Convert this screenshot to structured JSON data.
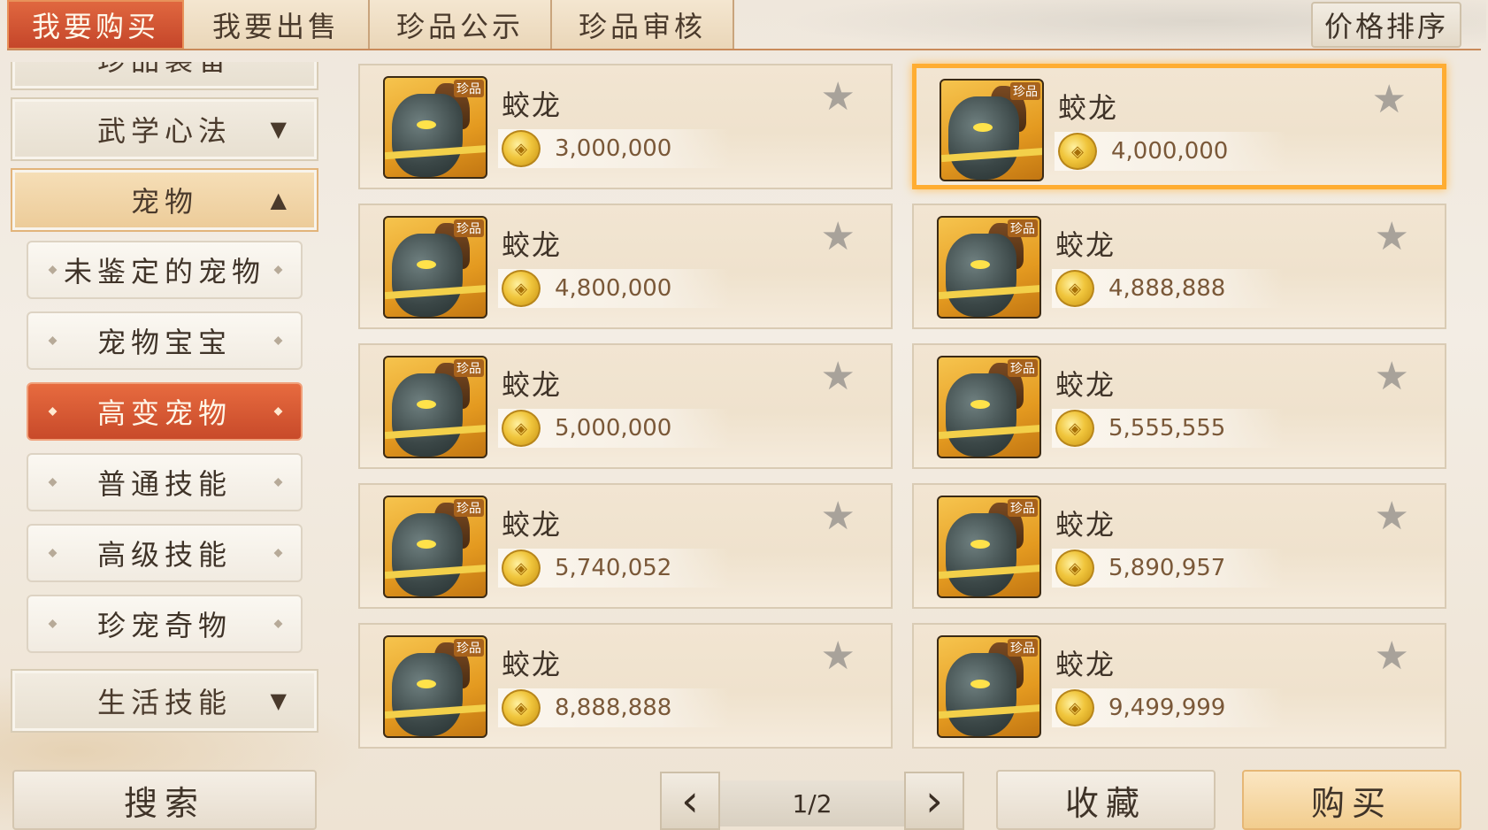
{
  "tabs": [
    {
      "label": "我要购买",
      "active": true
    },
    {
      "label": "我要出售",
      "active": false
    },
    {
      "label": "珍品公示",
      "active": false
    },
    {
      "label": "珍品审核",
      "active": false
    }
  ],
  "sort_label": "价格排序",
  "sidebar": {
    "partial_top": "珍品装备",
    "categories": [
      {
        "label": "武学心法",
        "arrow": "▼"
      },
      {
        "label": "宠物",
        "arrow": "▲"
      },
      {
        "label": "生活技能",
        "arrow": "▼"
      }
    ],
    "pet_subitems": [
      {
        "label": "未鉴定的宠物",
        "active": false
      },
      {
        "label": "宠物宝宝",
        "active": false
      },
      {
        "label": "高变宠物",
        "active": true
      },
      {
        "label": "普通技能",
        "active": false
      },
      {
        "label": "高级技能",
        "active": false
      },
      {
        "label": "珍宠奇物",
        "active": false
      }
    ]
  },
  "listings": [
    {
      "name": "蛟龙",
      "price": "3,000,000",
      "badge": "珍品",
      "selected": false
    },
    {
      "name": "蛟龙",
      "price": "4,000,000",
      "badge": "珍品",
      "selected": true
    },
    {
      "name": "蛟龙",
      "price": "4,800,000",
      "badge": "珍品",
      "selected": false
    },
    {
      "name": "蛟龙",
      "price": "4,888,888",
      "badge": "珍品",
      "selected": false
    },
    {
      "name": "蛟龙",
      "price": "5,000,000",
      "badge": "珍品",
      "selected": false
    },
    {
      "name": "蛟龙",
      "price": "5,555,555",
      "badge": "珍品",
      "selected": false
    },
    {
      "name": "蛟龙",
      "price": "5,740,052",
      "badge": "珍品",
      "selected": false
    },
    {
      "name": "蛟龙",
      "price": "5,890,957",
      "badge": "珍品",
      "selected": false
    },
    {
      "name": "蛟龙",
      "price": "8,888,888",
      "badge": "珍品",
      "selected": false
    },
    {
      "name": "蛟龙",
      "price": "9,499,999",
      "badge": "珍品",
      "selected": false
    }
  ],
  "bottom": {
    "search_label": "搜索",
    "page_indicator": "1/2",
    "favorite_label": "收藏",
    "buy_label": "购买"
  }
}
